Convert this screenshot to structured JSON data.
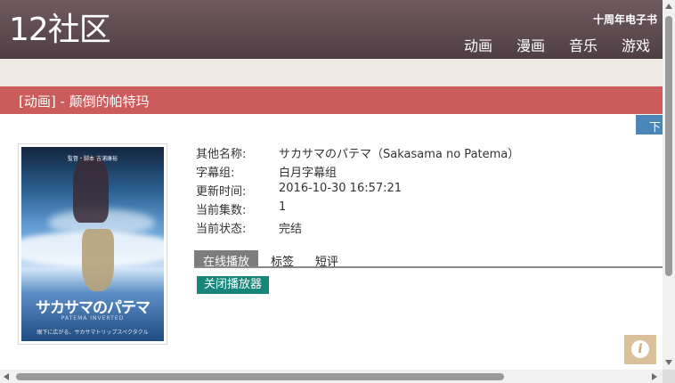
{
  "header": {
    "logo": "12社区",
    "promo": "十周年电子书",
    "nav": [
      "动画",
      "漫画",
      "音乐",
      "游戏"
    ]
  },
  "title_bar": {
    "text": "[动画] - 颠倒的帕特玛"
  },
  "side_tab": {
    "label": "下"
  },
  "poster": {
    "credit": "監督・脚本 吉浦康裕",
    "title": "サカサマのパテマ",
    "subtitle": "PATEMA INVERTED",
    "tagline": "眼下に広がる、サカサマトリップスペクタクル"
  },
  "info": [
    {
      "label": "其他名称:",
      "value": "サカサマのパテマ（Sakasama no Patema）"
    },
    {
      "label": "字幕组:",
      "value": "白月字幕组"
    },
    {
      "label": "更新时间:",
      "value": "2016-10-30 16:57:21"
    },
    {
      "label": "当前集数:",
      "value": "1"
    },
    {
      "label": "当前状态:",
      "value": "完结"
    }
  ],
  "tabs": [
    "在线播放",
    "标签",
    "短评"
  ],
  "close_player": "关闭播放器",
  "info_button": {
    "glyph": "i",
    "icon": "info-icon"
  },
  "colors": {
    "header": "#5c4a4f",
    "title_bar": "#cc5c5c",
    "side_tab": "#4a86b8",
    "close_button": "#16867a",
    "info_button": "#d9c09b"
  }
}
